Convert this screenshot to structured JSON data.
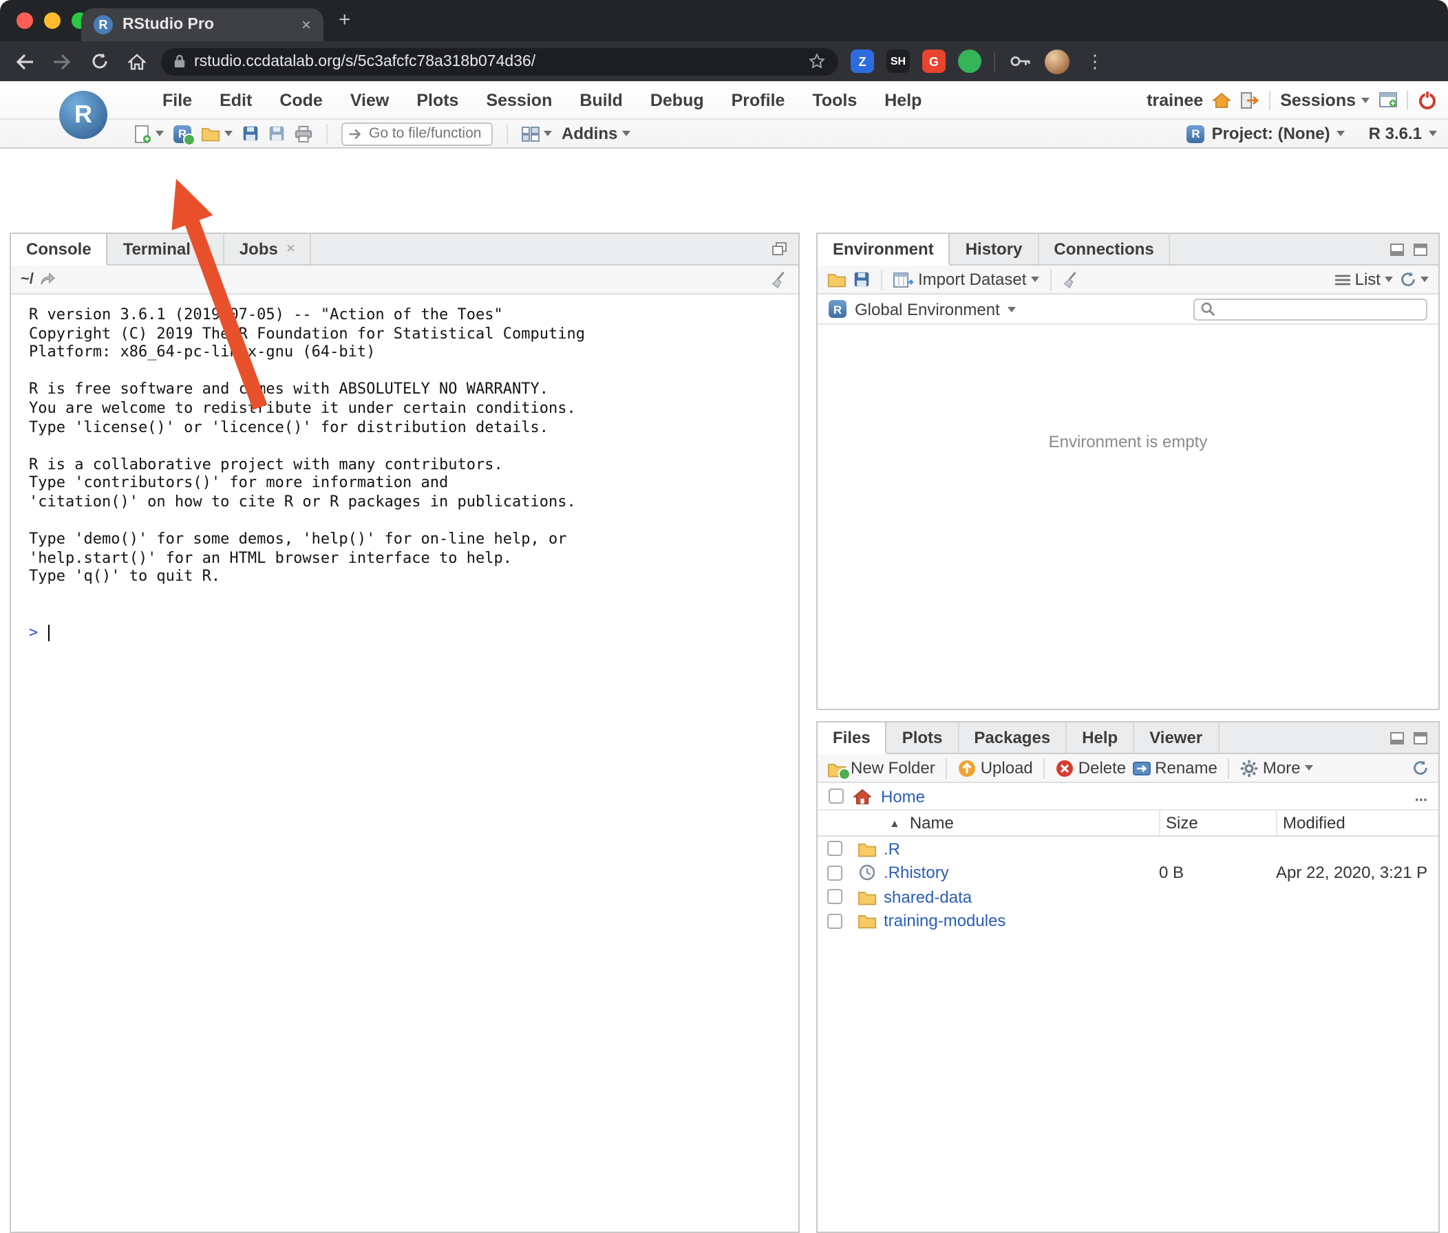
{
  "browser": {
    "tab": {
      "title": "RStudio Pro",
      "favicon_letter": "R"
    },
    "url": "rstudio.ccdatalab.org/s/5c3afcfc78a318b074d36/",
    "extensions": {
      "zotero": "Z",
      "sh": "SH",
      "grammarly": "G"
    }
  },
  "glyphs": {
    "close": "×",
    "new_tab": "+",
    "kebab": "⋮",
    "ellipsis": "...",
    "sort_asc": "▲"
  },
  "rstudio": {
    "logo_letter": "R",
    "menubar": {
      "items": [
        "File",
        "Edit",
        "Code",
        "View",
        "Plots",
        "Session",
        "Build",
        "Debug",
        "Profile",
        "Tools",
        "Help"
      ],
      "user": "trainee",
      "sessions_label": "Sessions"
    },
    "toolbar": {
      "goto_placeholder": "Go to file/function",
      "addins_label": "Addins",
      "project_label": "Project: (None)",
      "r_version_label": "R 3.6.1"
    },
    "console_pane": {
      "tabs": [
        {
          "label": "Console"
        },
        {
          "label": "Terminal"
        },
        {
          "label": "Jobs"
        }
      ],
      "path": "~/",
      "output": [
        "R version 3.6.1 (2019-07-05) -- \"Action of the Toes\"",
        "Copyright (C) 2019 The R Foundation for Statistical Computing",
        "Platform: x86_64-pc-linux-gnu (64-bit)",
        "",
        "R is free software and comes with ABSOLUTELY NO WARRANTY.",
        "You are welcome to redistribute it under certain conditions.",
        "Type 'license()' or 'licence()' for distribution details.",
        "",
        "R is a collaborative project with many contributors.",
        "Type 'contributors()' for more information and",
        "'citation()' on how to cite R or R packages in publications.",
        "",
        "Type 'demo()' for some demos, 'help()' for on-line help, or",
        "'help.start()' for an HTML browser interface to help.",
        "Type 'q()' to quit R.",
        ""
      ],
      "prompt": ">"
    },
    "environment_pane": {
      "tabs": [
        "Environment",
        "History",
        "Connections"
      ],
      "import_dataset_label": "Import Dataset",
      "scope_label": "Global Environment",
      "list_label": "List",
      "empty_message": "Environment is empty"
    },
    "files_pane": {
      "tabs": [
        "Files",
        "Plots",
        "Packages",
        "Help",
        "Viewer"
      ],
      "new_folder_label": "New Folder",
      "upload_label": "Upload",
      "delete_label": "Delete",
      "rename_label": "Rename",
      "more_label": "More",
      "breadcrumb": "Home",
      "columns": {
        "name": "Name",
        "size": "Size",
        "modified": "Modified"
      },
      "rows": [
        {
          "icon": "folder",
          "name": ".R",
          "size": "",
          "modified": ""
        },
        {
          "icon": "history",
          "name": ".Rhistory",
          "size": "0 B",
          "modified": "Apr 22, 2020, 3:21 P"
        },
        {
          "icon": "folder",
          "name": "shared-data",
          "size": "",
          "modified": ""
        },
        {
          "icon": "folder",
          "name": "training-modules",
          "size": "",
          "modified": ""
        }
      ]
    }
  },
  "annotation": {
    "type": "arrow",
    "target": "terminal-tab",
    "color": "#e8502c"
  },
  "colors": {
    "accent_arrow": "#e8502c",
    "link_blue": "#2a5db8",
    "console_prompt_blue": "#2a52be",
    "power_red": "#cf3b30"
  }
}
